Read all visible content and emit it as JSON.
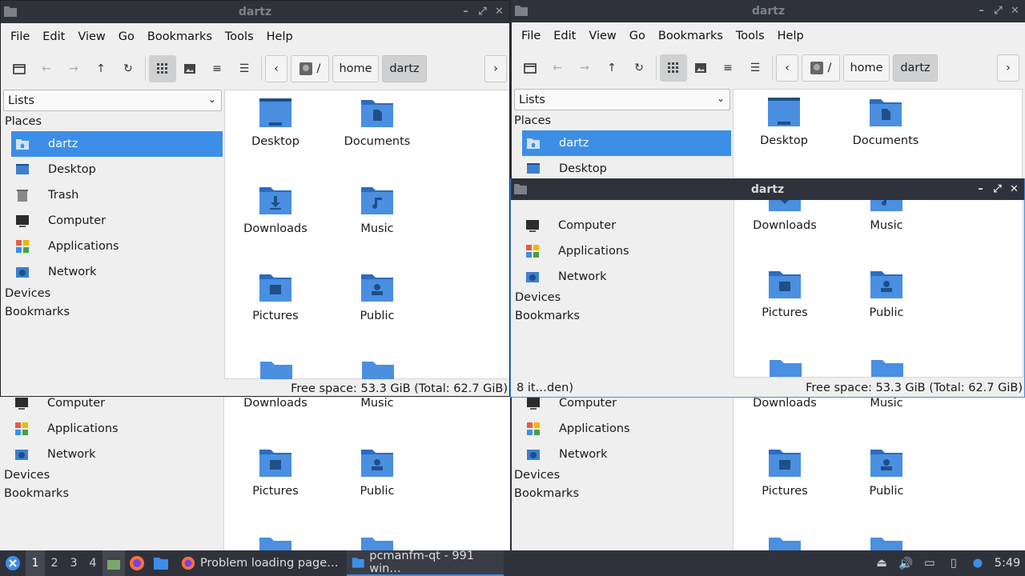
{
  "window_title": "dartz",
  "menu": [
    "File",
    "Edit",
    "View",
    "Go",
    "Bookmarks",
    "Tools",
    "Help"
  ],
  "path": {
    "root": "/",
    "segments": [
      "home",
      "dartz"
    ]
  },
  "side_combo": "Lists",
  "sidebar": {
    "places_header": "Places",
    "items": [
      {
        "label": "dartz",
        "icon": "home-folder-icon"
      },
      {
        "label": "Desktop",
        "icon": "desktop-icon"
      },
      {
        "label": "Trash",
        "icon": "trash-icon"
      },
      {
        "label": "Computer",
        "icon": "computer-icon"
      },
      {
        "label": "Applications",
        "icon": "applications-icon"
      },
      {
        "label": "Network",
        "icon": "network-icon"
      }
    ],
    "devices_header": "Devices",
    "bookmarks_header": "Bookmarks"
  },
  "files": [
    {
      "label": "Desktop",
      "icon": "desktop-folder-icon"
    },
    {
      "label": "Documents",
      "icon": "documents-folder-icon"
    },
    {
      "label": "Downloads",
      "icon": "downloads-folder-icon"
    },
    {
      "label": "Music",
      "icon": "music-folder-icon"
    },
    {
      "label": "Pictures",
      "icon": "pictures-folder-icon"
    },
    {
      "label": "Public",
      "icon": "public-folder-icon"
    }
  ],
  "status": {
    "free": "Free space: 53.3 GiB (Total: 62.7 GiB)",
    "items": "8 it…den)"
  },
  "taskbar": {
    "workspaces": [
      "1",
      "2",
      "3",
      "4"
    ],
    "tasks": [
      {
        "label": "Problem loading page…",
        "icon": "firefox-icon"
      },
      {
        "label": "pcmanfm-qt - 991 win…",
        "icon": "folder-icon"
      }
    ],
    "clock": "5:49"
  },
  "colors": {
    "accent": "#3d8ee6",
    "folder": "#4a8fe0",
    "folder_dark": "#1f5fa8",
    "titlebar": "#2f323b"
  }
}
